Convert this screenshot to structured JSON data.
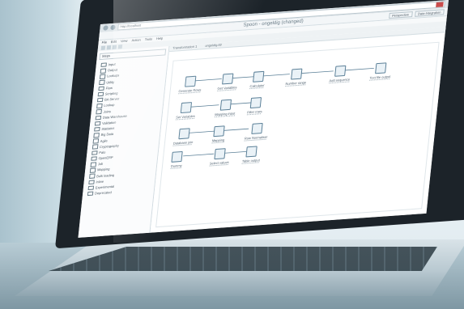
{
  "browser": {
    "url": "http://localhost"
  },
  "app": {
    "title": "Spoon - ongeldig (changed)"
  },
  "menu": [
    "File",
    "Edit",
    "View",
    "Action",
    "Tools",
    "Help"
  ],
  "perspective_buttons": [
    "Perspective",
    "Data Integration"
  ],
  "sidebar": {
    "search_value": "Steps",
    "items": [
      "Input",
      "Output",
      "Lookups",
      "Utility",
      "Flow",
      "Scripting",
      "BA Server",
      "Lookup",
      "Joins",
      "Data Warehouse",
      "Validation",
      "Statistics",
      "Big Data",
      "Agile",
      "Cryptography",
      "Palo",
      "OpenERP",
      "Job",
      "Mapping",
      "Bulk loading",
      "Inline",
      "Experimental",
      "Deprecated"
    ]
  },
  "tabs": [
    "Transformation 1",
    "ongeldig.ktr"
  ],
  "nodes": [
    "Generate Rows",
    "Get Variables",
    "Calculator",
    "Number range",
    "Add sequence",
    "Text file output",
    "Set Variables",
    "Mapping input",
    "Filter rows",
    "Database join",
    "Mapping",
    "Row Normaliser",
    "Dummy",
    "Select values",
    "Table output"
  ],
  "colors": {
    "node_border": "#5a7f97",
    "accent_close": "#c94c4c"
  }
}
